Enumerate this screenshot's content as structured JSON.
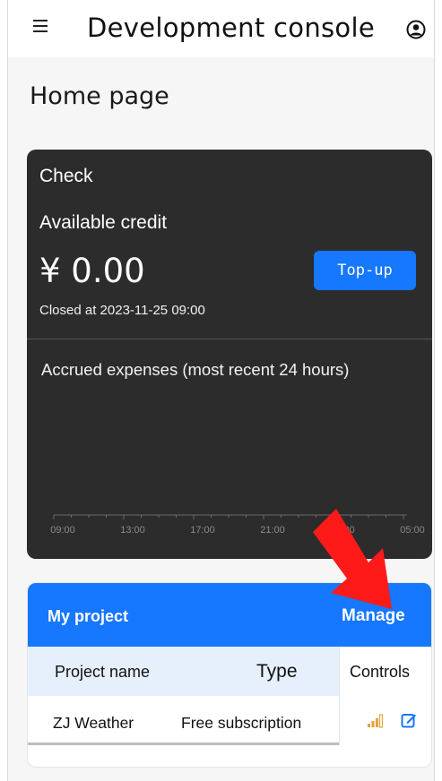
{
  "topbar": {
    "title": "Development console",
    "menu_icon": "hamburger-menu-icon",
    "account_icon": "user-account-icon"
  },
  "page": {
    "title": "Home page"
  },
  "check_card": {
    "title": "Check",
    "credit_label": "Available credit",
    "credit_amount": "¥ 0.00",
    "topup_label": "Top-up",
    "closed_at": "Closed at 2023-11-25 09:00",
    "expenses_title": "Accrued expenses (most recent 24 hours)",
    "axis_ticks": [
      "09:00",
      "13:00",
      "17:00",
      "21:00",
      "01:00",
      "05:00"
    ]
  },
  "project_card": {
    "title": "My project",
    "manage_label": "Manage",
    "columns": [
      "Project name",
      "Type",
      "Controls"
    ],
    "rows": [
      {
        "name": "ZJ Weather",
        "type": "Free subscription",
        "controls": [
          "stats-icon",
          "edit-icon"
        ]
      }
    ]
  },
  "colors": {
    "accent": "#1677ff",
    "card_dark": "#2c2c2c",
    "table_head": "#e6f0fd",
    "annotation": "#ff1a1a",
    "stats_icon": "#e8a23a"
  }
}
